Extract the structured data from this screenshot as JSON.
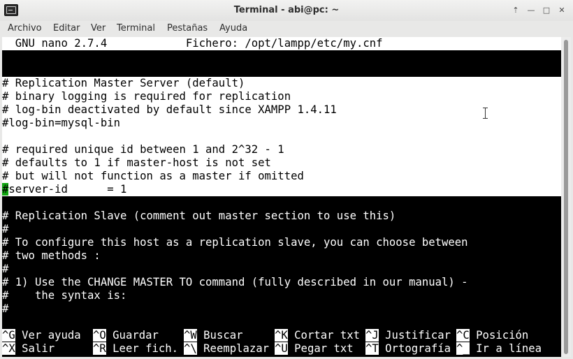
{
  "window": {
    "title": "Terminal - abi@pc: ~",
    "buttons": {
      "up": "⇡",
      "minimize": "—",
      "maximize": "□",
      "close": "✕"
    }
  },
  "menubar": [
    "Archivo",
    "Editar",
    "Ver",
    "Terminal",
    "Pestañas",
    "Ayuda"
  ],
  "nano": {
    "header": "  GNU nano 2.7.4            Fichero: /opt/lampp/etc/my.cnf",
    "lines": [
      "",
      "# Replication Master Server (default)",
      "# binary logging is required for replication",
      "# log-bin deactivated by default since XAMPP 1.4.11",
      "#log-bin=mysql-bin",
      "",
      "# required unique id between 1 and 2^32 - 1",
      "# defaults to 1 if master-host is not set",
      "# but will not function as a master if omitted",
      "#server-id      = 1",
      "",
      "# Replication Slave (comment out master section to use this)",
      "#",
      "# To configure this host as a replication slave, you can choose between",
      "# two methods :",
      "#",
      "# 1) Use the CHANGE MASTER TO command (fully described in our manual) -",
      "#    the syntax is:",
      "#"
    ],
    "cursor_line_text": "server-id      = 1",
    "cursor_char": "#",
    "shortcuts_row1": [
      {
        "key": "^G",
        "label": " Ver ayuda"
      },
      {
        "key": "^O",
        "label": " Guardar"
      },
      {
        "key": "^W",
        "label": " Buscar"
      },
      {
        "key": "^K",
        "label": " Cortar txt"
      },
      {
        "key": "^J",
        "label": " Justificar"
      },
      {
        "key": "^C",
        "label": " Posición"
      }
    ],
    "shortcuts_row2": [
      {
        "key": "^X",
        "label": " Salir"
      },
      {
        "key": "^R",
        "label": " Leer fich."
      },
      {
        "key": "^\\",
        "label": " Reemplazar"
      },
      {
        "key": "^U",
        "label": " Pegar txt"
      },
      {
        "key": "^T",
        "label": " Ortografía"
      },
      {
        "key": "^_",
        "label": " Ir a línea"
      }
    ]
  }
}
